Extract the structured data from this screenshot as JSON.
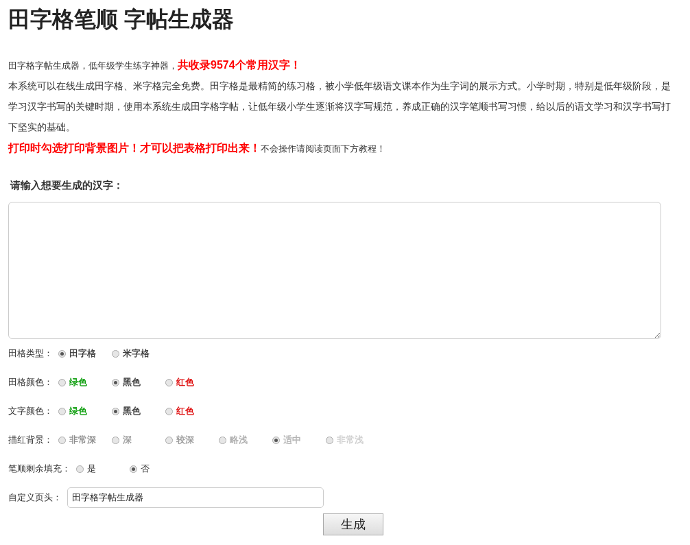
{
  "title": "田字格笔顺 字帖生成器",
  "intro": {
    "lead": "田字格字帖生成器，低年级学生练字神器，",
    "highlight": "共收录9574个常用汉字！",
    "body": "本系统可以在线生成田字格、米字格完全免费。田字格是最精简的练习格，被小学低年级语文课本作为生字词的展示方式。小学时期，特别是低年级阶段，是学习汉字书写的关键时期，使用本系统生成田字格字帖，让低年级小学生逐渐将汉字写规范，养成正确的汉字笔顺书写习惯，给以后的语文学习和汉字书写打下坚实的基础。",
    "warning": "打印时勾选打印背景图片！才可以把表格打印出来！",
    "note": "不会操作请阅读页面下方教程！"
  },
  "input_label": "请输入想要生成的汉字：",
  "options": [
    {
      "label": "田格类型：",
      "choices": [
        {
          "label": "田字格",
          "selected": true,
          "color": "#333333"
        },
        {
          "label": "米字格",
          "selected": false,
          "color": "#333333"
        }
      ]
    },
    {
      "label": "田格颜色：",
      "choices": [
        {
          "label": "绿色",
          "selected": false,
          "color": "#009900"
        },
        {
          "label": "黑色",
          "selected": true,
          "color": "#333333"
        },
        {
          "label": "红色",
          "selected": false,
          "color": "#dd0000"
        }
      ]
    },
    {
      "label": "文字颜色：",
      "choices": [
        {
          "label": "绿色",
          "selected": false,
          "color": "#009900"
        },
        {
          "label": "黑色",
          "selected": true,
          "color": "#333333"
        },
        {
          "label": "红色",
          "selected": false,
          "color": "#dd0000"
        }
      ]
    },
    {
      "label": "描红背景：",
      "choices": [
        {
          "label": "非常深",
          "selected": false,
          "color": "#888888"
        },
        {
          "label": "深",
          "selected": false,
          "color": "#999999"
        },
        {
          "label": "较深",
          "selected": false,
          "color": "#999999"
        },
        {
          "label": "略浅",
          "selected": false,
          "color": "#aaaaaa"
        },
        {
          "label": "适中",
          "selected": true,
          "color": "#b0b0b0"
        },
        {
          "label": "非常浅",
          "selected": false,
          "color": "#cccccc"
        }
      ]
    },
    {
      "label": "笔顺剩余填充：",
      "choices": [
        {
          "label": "是",
          "selected": false
        },
        {
          "label": "否",
          "selected": true
        }
      ]
    }
  ],
  "header_field": {
    "label": "自定义页头：",
    "value": "田字格字帖生成器"
  },
  "button": "生成"
}
